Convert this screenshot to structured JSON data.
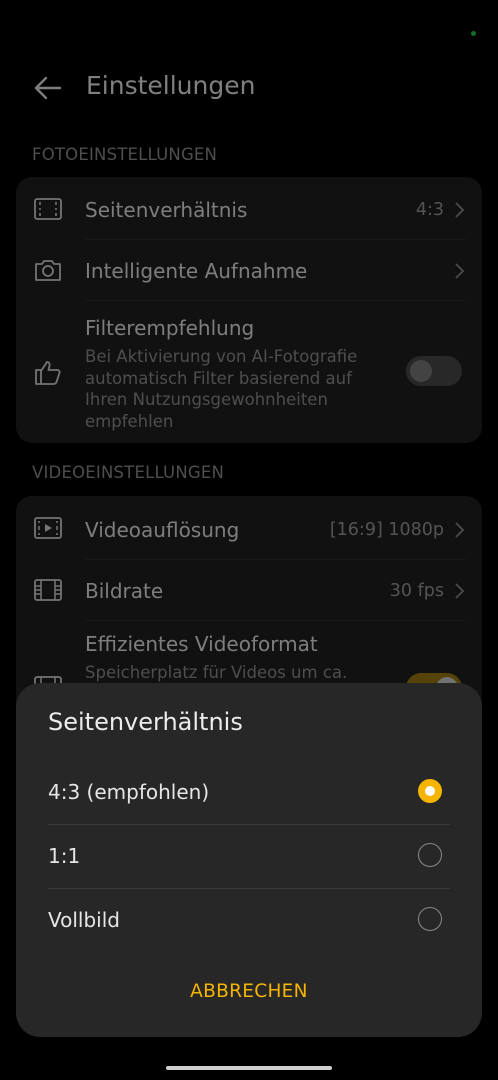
{
  "header": {
    "title": "Einstellungen"
  },
  "photo_section": {
    "label": "FOTOEINSTELLUNGEN",
    "aspect": {
      "label": "Seitenverhältnis",
      "value": "4:3"
    },
    "smart_capture": {
      "label": "Intelligente Aufnahme"
    },
    "filter": {
      "label": "Filterempfehlung",
      "description": "Bei Aktivierung von AI-Fotografie automatisch Filter basierend auf Ihren Nutzungsgewohnheiten empfehlen",
      "enabled": false
    }
  },
  "video_section": {
    "label": "VIDEOEINSTELLUNGEN",
    "resolution": {
      "label": "Videoauflösung",
      "value": "[16:9] 1080p"
    },
    "framerate": {
      "label": "Bildrate",
      "value": "30 fps"
    },
    "efficient": {
      "label": "Effizientes Videoformat",
      "description": "Speicherplatz für Videos um ca.",
      "enabled": true
    }
  },
  "dialog": {
    "title": "Seitenverhältnis",
    "options": [
      {
        "label": "4:3 (empfohlen)",
        "selected": true
      },
      {
        "label": "1:1",
        "selected": false
      },
      {
        "label": "Vollbild",
        "selected": false
      }
    ],
    "cancel_label": "ABBRECHEN"
  },
  "colors": {
    "accent": "#f5b400",
    "card": "#1f1f1f",
    "sheet": "#272727",
    "background": "#000000"
  }
}
